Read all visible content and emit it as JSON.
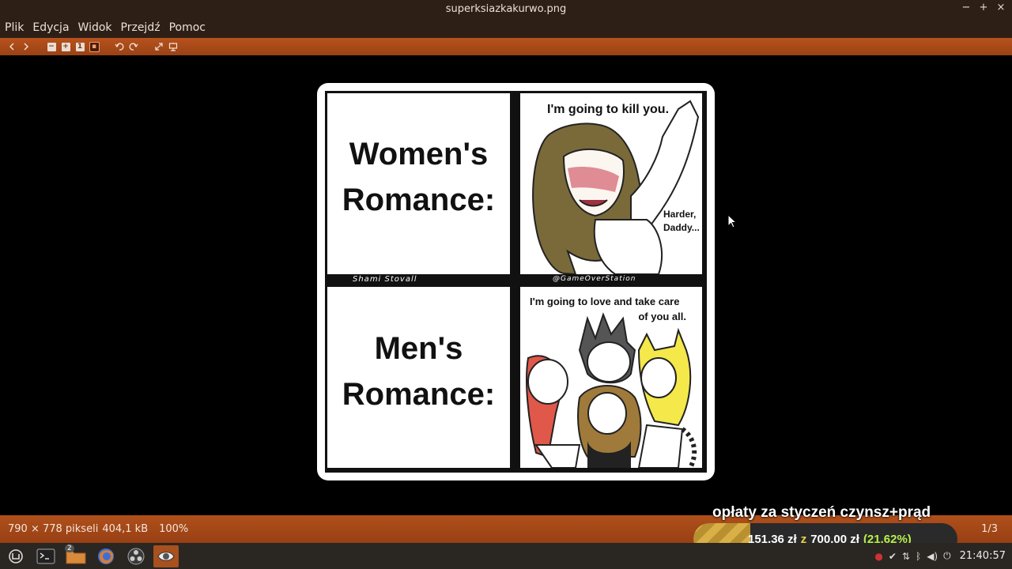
{
  "window": {
    "title": "superksiazkakurwo.png",
    "controls": [
      "−",
      "+",
      "×"
    ]
  },
  "menu": {
    "items": [
      "Plik",
      "Edycja",
      "Widok",
      "Przejdź",
      "Pomoc"
    ]
  },
  "toolbar": {
    "icons": [
      "back-arrow-icon",
      "forward-arrow-icon",
      "zoom-out-icon",
      "zoom-in-icon",
      "zoom-normal-icon",
      "zoom-fit-icon",
      "rotate-left-icon",
      "rotate-right-icon",
      "fullscreen-icon",
      "slideshow-icon"
    ],
    "zoom_normal_label": "1"
  },
  "comic": {
    "top_left_label_line1": "Women's",
    "top_left_label_line2": "Romance:",
    "bottom_left_label_line1": "Men's",
    "bottom_left_label_line2": "Romance:",
    "top_right_speech": "I'm going to kill you.",
    "top_right_reply_line1": "Harder,",
    "top_right_reply_line2": "Daddy...",
    "bottom_right_speech_line1": "I'm going to love and take care",
    "bottom_right_speech_line2": "of you all.",
    "credit_left": "Shami Stovall",
    "credit_right": "@GameOverStation"
  },
  "status": {
    "dimensions": "790 × 778 pikseli",
    "filesize": "404,1 kB",
    "zoom": "100%",
    "page": "1/3"
  },
  "donation": {
    "title": "opłaty za styczeń czynsz+prąd",
    "current": "151,36 zł",
    "of_label": "z",
    "goal": "700,00 zł",
    "percent_label": "(21.62%)",
    "progress_fraction": 0.2162
  },
  "taskbar": {
    "apps": [
      "menu-icon",
      "terminal-icon",
      "files-icon",
      "firefox-icon",
      "obs-icon",
      "image-viewer-icon"
    ],
    "files_badge": "2",
    "clock": "21:40:57"
  },
  "colors": {
    "accent": "#a8501e",
    "titlebar": "#2e1f16",
    "donation_fill": "#d9b048",
    "percent": "#b8f04a"
  }
}
